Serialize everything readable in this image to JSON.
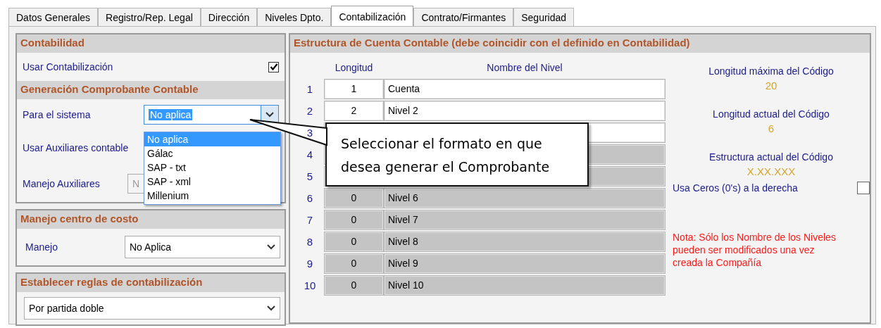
{
  "tabs": [
    {
      "label": "Datos Generales",
      "selected": false
    },
    {
      "label": "Registro/Rep. Legal",
      "selected": false
    },
    {
      "label": "Dirección",
      "selected": false
    },
    {
      "label": "Niveles Dpto.",
      "selected": false
    },
    {
      "label": "Contabilización",
      "selected": true
    },
    {
      "label": "Contrato/Firmantes",
      "selected": false
    },
    {
      "label": "Seguridad",
      "selected": false
    }
  ],
  "contabilidad": {
    "title": "Contabilidad",
    "usar_label": "Usar Contabilización",
    "usar_checked": true,
    "generacion_title": "Generación Comprobante Contable",
    "sistema_label": "Para el sistema",
    "sistema_value": "No aplica",
    "sistema_open": true,
    "sistema_options": [
      {
        "label": "No aplica",
        "selected": true
      },
      {
        "label": "Gálac",
        "selected": false
      },
      {
        "label": "SAP - txt",
        "selected": false
      },
      {
        "label": "SAP - xml",
        "selected": false
      },
      {
        "label": "Millenium",
        "selected": false
      }
    ],
    "auxiliares_label": "Usar Auxiliares contable",
    "manejo_aux_label": "Manejo Auxiliares",
    "manejo_aux_value": "N"
  },
  "centro_costo": {
    "title": "Manejo centro de costo",
    "manejo_label": "Manejo",
    "manejo_value": "No Aplica"
  },
  "reglas": {
    "title": "Establecer reglas de contabilización",
    "value": "Por partida doble"
  },
  "estructura": {
    "title": "Estructura de Cuenta Contable (debe coincidir con el definido en Contabilidad)",
    "columns": [
      "Longitud",
      "Nombre del Nivel"
    ],
    "rows": [
      {
        "number": "1",
        "length": "1",
        "name": "Cuenta",
        "enabled": true
      },
      {
        "number": "2",
        "length": "2",
        "name": "Nivel 2",
        "enabled": true
      },
      {
        "number": "3",
        "enabled": true
      },
      {
        "number": "4",
        "enabled": false
      },
      {
        "number": "5",
        "enabled": false
      },
      {
        "number": "6",
        "length": "0",
        "name": "Nivel 6",
        "enabled": false
      },
      {
        "number": "7",
        "length": "0",
        "name": "Nivel 7",
        "enabled": false
      },
      {
        "number": "8",
        "length": "0",
        "name": "Nivel 8",
        "enabled": false
      },
      {
        "number": "9",
        "length": "0",
        "name": "Nivel 9",
        "enabled": false
      },
      {
        "number": "10",
        "length": "0",
        "name": "Nivel 10",
        "enabled": false
      }
    ],
    "info": [
      {
        "label": "Longitud máxima del Código",
        "value": "20"
      },
      {
        "label": "Longitud actual del Código",
        "value": "6"
      },
      {
        "label": "Estructura actual del Código",
        "value": "X.XX.XXX"
      }
    ],
    "ceros_label": "Usa Ceros (0's) a la derecha",
    "ceros_checked": false,
    "note": "Nota: Sólo los Nombre de los Niveles pueden ser modificados una vez creada la Compañía"
  },
  "callout": {
    "text": "Seleccionar el formato en que desea generar el Comprobante"
  }
}
